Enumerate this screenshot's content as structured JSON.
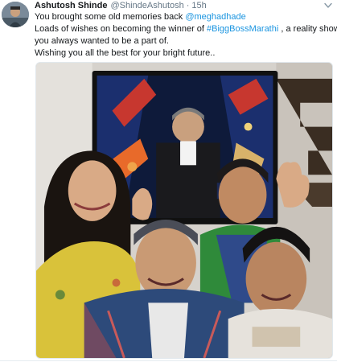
{
  "tweet": {
    "author_name": "Ashutosh Shinde",
    "author_handle": "@ShindeAshutosh",
    "separator": "·",
    "timestamp": "15h",
    "lines": [
      {
        "before": "You brought some old memories back ",
        "mention": "@meghadhade",
        "after": ""
      },
      {
        "before": "Loads of wishes on becoming the winner of ",
        "hashtag": "#BiggBossMarathi",
        "after": " , a reality show"
      },
      {
        "text": "you always wanted to be a part of."
      },
      {
        "text": "Wishing you all the best for your bright future.."
      }
    ],
    "icons": {
      "avatar": "profile-photo",
      "menu": "chevron-down-icon"
    },
    "colors": {
      "link": "#1b95e0",
      "text": "#14171a",
      "muted": "#657786"
    }
  },
  "photo": {
    "description_text": "",
    "tv_caption": ""
  }
}
